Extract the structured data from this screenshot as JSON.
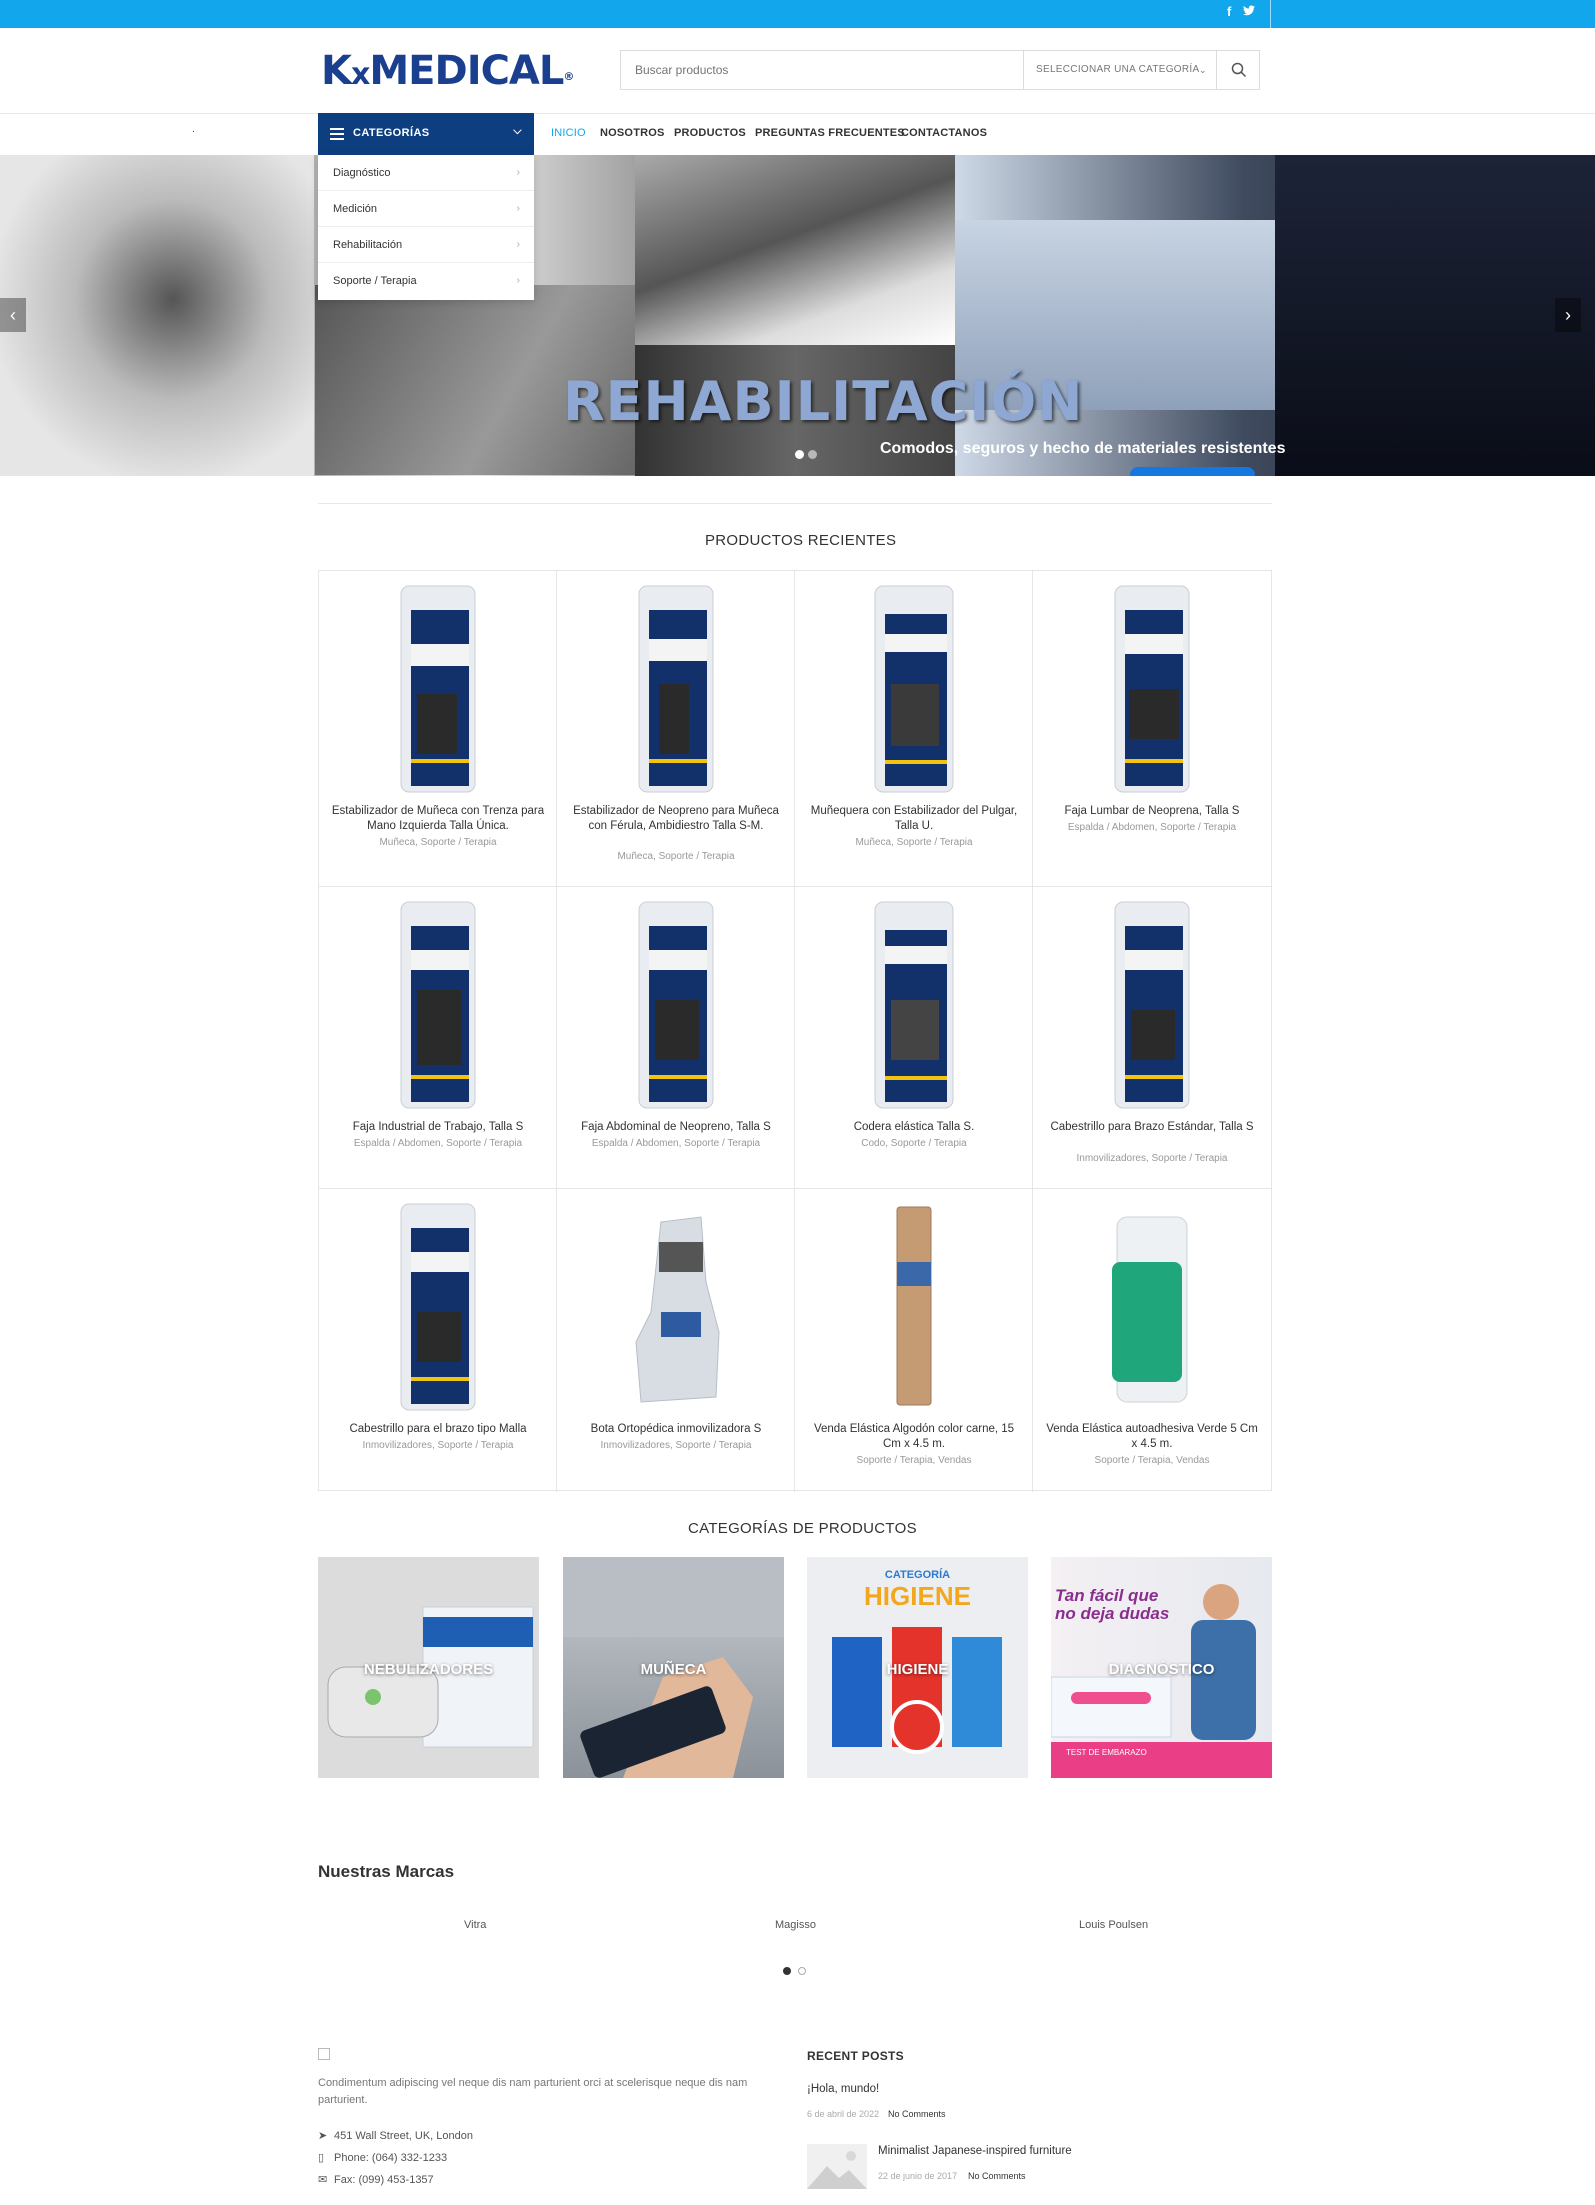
{
  "topbar": {
    "facebook": "f",
    "twitter": "t"
  },
  "header": {
    "logo_k": "K",
    "logo_x": "x",
    "logo_medical": "MEDICAL",
    "logo_reg": "®",
    "search_placeholder": "Buscar productos",
    "category_select": "SELECCIONAR UNA CATEGORÍA"
  },
  "nav": {
    "categories_label": "CATEGORÍAS",
    "dot": ".",
    "items": [
      "INICIO",
      "NOSOTROS",
      "PRODUCTOS",
      "PREGUNTAS FRECUENTES",
      "CONTACTANOS"
    ]
  },
  "dropdown": [
    "Diagnóstico",
    "Medición",
    "Rehabilitación",
    "Soporte / Terapia"
  ],
  "hero": {
    "title": "REHABILITACIÓN",
    "subtitle": "Comodos, seguros y hecho de materiales resistentes",
    "active_slide": 1,
    "slides": 2
  },
  "recent": {
    "title": "PRODUCTOS RECIENTES",
    "products": [
      {
        "name": "Estabilizador de Muñeca con Trenza para Mano Izquierda Talla Única.",
        "cat": "Muñeca, Soporte / Terapia"
      },
      {
        "name": "Estabilizador de Neopreno para Muñeca con Férula, Ambidiestro Talla S-M.",
        "cat": "Muñeca, Soporte / Terapia"
      },
      {
        "name": "Muñequera con Estabilizador del Pulgar, Talla U.",
        "cat": "Muñeca, Soporte / Terapia"
      },
      {
        "name": "Faja Lumbar de Neoprena, Talla S",
        "cat": "Espalda / Abdomen, Soporte / Terapia"
      },
      {
        "name": "Faja Industrial de Trabajo, Talla S",
        "cat": "Espalda / Abdomen, Soporte / Terapia"
      },
      {
        "name": "Faja Abdominal de Neopreno, Talla S",
        "cat": "Espalda / Abdomen, Soporte / Terapia"
      },
      {
        "name": "Codera elástica Talla S.",
        "cat": "Codo, Soporte / Terapia"
      },
      {
        "name": "Cabestrillo para Brazo Estándar, Talla S",
        "cat": "Inmovilizadores, Soporte / Terapia"
      },
      {
        "name": "Cabestrillo para el brazo tipo Malla",
        "cat": "Inmovilizadores, Soporte / Terapia"
      },
      {
        "name": "Bota Ortopédica inmovilizadora S",
        "cat": "Inmovilizadores, Soporte / Terapia"
      },
      {
        "name": "Venda Elástica Algodón color carne, 15 Cm x 4.5 m.",
        "cat": "Soporte / Terapia, Vendas"
      },
      {
        "name": "Venda Elástica autoadhesiva Verde 5 Cm x 4.5 m.",
        "cat": "Soporte / Terapia, Vendas"
      }
    ]
  },
  "categories": {
    "title": "CATEGORÍAS DE PRODUCTOS",
    "items": [
      "NEBULIZADORES",
      "MUÑECA",
      "HIGIENE",
      "DIAGNÓSTICO"
    ],
    "higiene_banner_top": "CATEGORÍA",
    "higiene_banner": "HIGIENE",
    "diag_banner": "Tan fácil que no deja dudas",
    "diag_small": "TEST DE EMBARAZO"
  },
  "brands": {
    "title": "Nuestras Marcas",
    "items": [
      "Vitra",
      "Magisso",
      "Louis Poulsen"
    ]
  },
  "footer": {
    "desc": "Condimentum adipiscing vel neque dis nam parturient orci at scelerisque neque dis nam parturient.",
    "address": "451 Wall Street, UK, London",
    "phone": "Phone: (064) 332-1233",
    "fax": "Fax: (099) 453-1357",
    "recent_title": "RECENT POSTS",
    "posts": [
      {
        "name": "¡Hola, mundo!",
        "date": "6 de abril de 2022",
        "comments": "No Comments"
      },
      {
        "name": "Minimalist Japanese-inspired furniture",
        "date": "22 de junio de 2017",
        "comments": "No Comments"
      }
    ]
  }
}
